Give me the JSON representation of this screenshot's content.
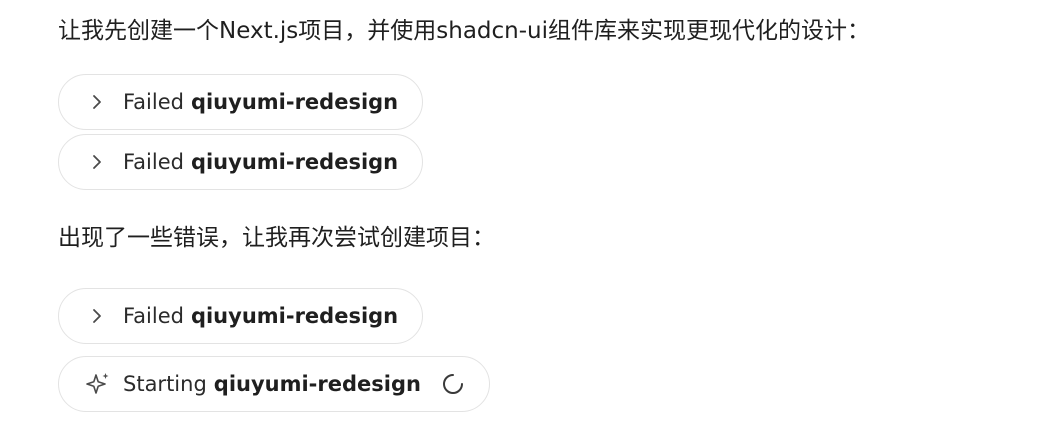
{
  "messages": {
    "intro": "让我先创建一个Next.js项目，并使用shadcn-ui组件库来实现更现代化的设计：",
    "retry": "出现了一些错误，让我再次尝试创建项目："
  },
  "tool_calls": [
    {
      "status": "Failed",
      "name": "qiuyumi-redesign",
      "icon": "chevron-right-icon"
    },
    {
      "status": "Failed",
      "name": "qiuyumi-redesign",
      "icon": "chevron-right-icon"
    },
    {
      "status": "Failed",
      "name": "qiuyumi-redesign",
      "icon": "chevron-right-icon"
    },
    {
      "status": "Starting",
      "name": "qiuyumi-redesign",
      "icon": "sparkle-icon",
      "indicator": "loading-spinner-icon"
    }
  ],
  "colors": {
    "text": "#1f1f1f",
    "pill_border": "#e3e3e3",
    "icon": "#4a4a4a"
  }
}
